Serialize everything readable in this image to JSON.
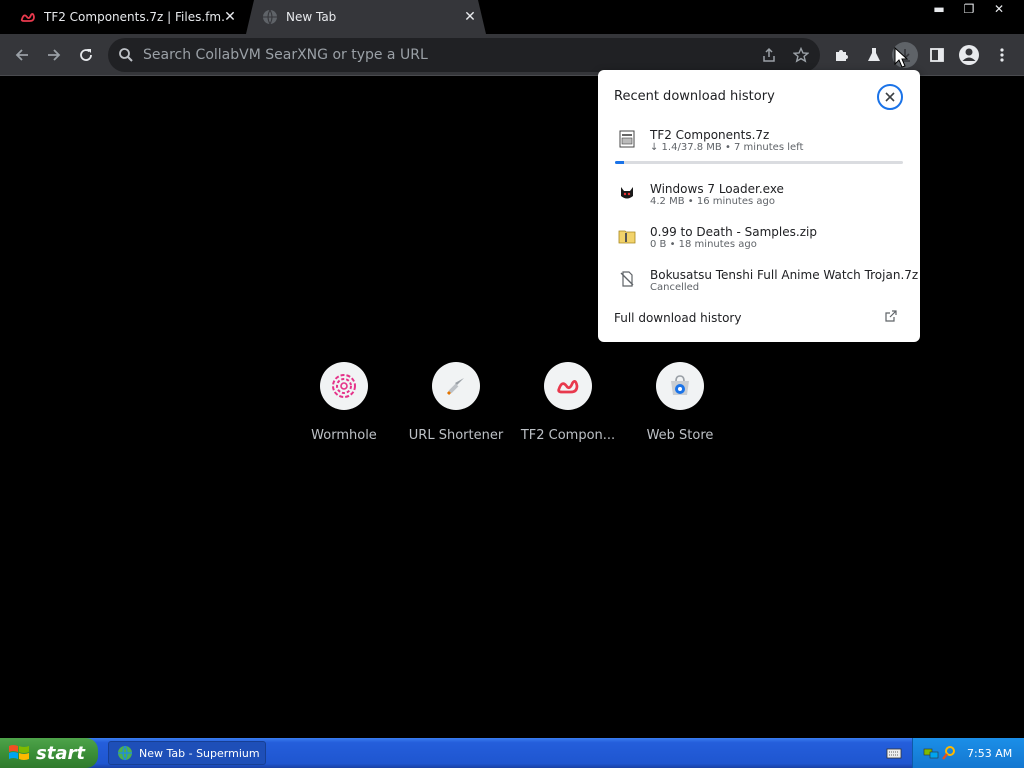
{
  "tabs": [
    {
      "title": "TF2 Components.7z | Files.fm.",
      "active": false
    },
    {
      "title": "New Tab",
      "active": true
    }
  ],
  "omnibox": {
    "placeholder": "Search CollabVM SearXNG or type a URL"
  },
  "shortcuts": [
    {
      "label": "Wormhole",
      "icon": "wormhole-icon"
    },
    {
      "label": "URL Shortener",
      "icon": "rocket-icon"
    },
    {
      "label": "TF2 Compon...",
      "icon": "filesfm-icon"
    },
    {
      "label": "Web Store",
      "icon": "webstore-icon"
    }
  ],
  "downloads": {
    "title": "Recent download history",
    "items": [
      {
        "name": "TF2 Components.7z",
        "status": "↓ 1.4/37.8 MB • 7 minutes left",
        "progress": 0.03,
        "icon": "archive-file-icon"
      },
      {
        "name": "Windows  7  Loader.exe",
        "status": "4.2 MB • 16 minutes ago",
        "icon": "cat-exe-icon"
      },
      {
        "name": "0.99 to Death - Samples.zip",
        "status": "0 B • 18 minutes ago",
        "icon": "zip-folder-icon"
      },
      {
        "name": "Bokusatsu Tenshi Full Anime Watch Trojan.7z",
        "status": "Cancelled",
        "icon": "file-cancelled-icon"
      }
    ],
    "full_history_label": "Full download history"
  },
  "taskbar": {
    "start_label": "start",
    "window_label": "New Tab - Supermium",
    "clock": "7:53 AM"
  },
  "colors": {
    "accent": "#1a73e8",
    "toolbar": "#35363a",
    "taskbar": "#245edb",
    "start": "#3b8f38"
  }
}
